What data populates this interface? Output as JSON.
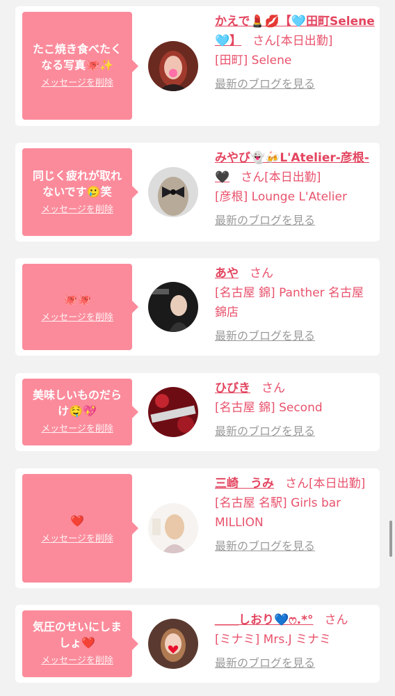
{
  "colors": {
    "bubble": "#fb8b9b",
    "accent": "#e8526c",
    "blog_link": "#9a9a9a",
    "background": "#f2f2f3"
  },
  "delete_label": "メッセージを削除",
  "blog_label": "最新のブログを見る",
  "san_label": "さん",
  "items": [
    {
      "message": "たこ焼き食べたくなる写真🐙✨",
      "name": "かえで💄💋【🩵田町Selene🩵】",
      "status": "[本日出勤]",
      "shop": "[田町] Selene",
      "avatar_icon": "woman-photo-icon"
    },
    {
      "message": "同じく疲れが取れないです🥲笑",
      "name": "みやび👻🍻L'Atelier-彦根-🖤",
      "status": "[本日出勤]",
      "shop": "[彦根] Lounge L'Atelier",
      "avatar_icon": "hair-bow-photo-icon"
    },
    {
      "message": "🐙🐙",
      "name": "あや",
      "status": "",
      "shop": "[名古屋 錦] Panther 名古屋錦店",
      "avatar_icon": "panther-photo-icon"
    },
    {
      "message": "美味しいものだらけ🤤💖",
      "name": "ひびき",
      "status": "",
      "shop": "[名古屋 錦] Second",
      "avatar_icon": "second-logo-icon"
    },
    {
      "message": "❤️",
      "name": "三崎　うみ",
      "status": "[本日出勤]",
      "shop": "[名古屋 名駅] Girls bar MILLION",
      "avatar_icon": "million-photo-icon"
    },
    {
      "message": "気圧のせいにしましょ❤️",
      "name": "＿＿しおり💙ෆ.*°",
      "status": "",
      "shop": "[ミナミ] Mrs.J ミナミ",
      "avatar_icon": "heart-photo-icon"
    }
  ]
}
